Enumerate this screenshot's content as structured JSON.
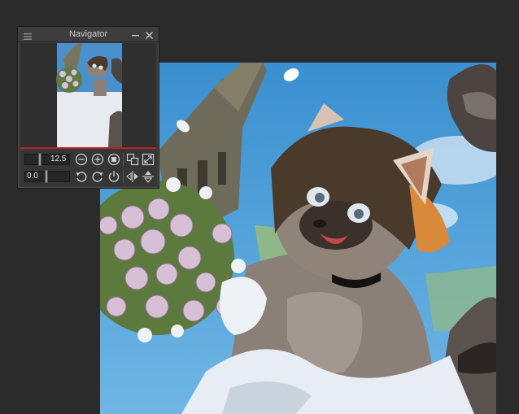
{
  "navigator": {
    "title": "Navigator",
    "zoom_value": "12.5",
    "rotation_value": "0.0",
    "accent_color": "#b82222"
  },
  "icons": {
    "panel_menu": "hamburger-icon",
    "minimize": "minimize-icon",
    "close": "close-icon",
    "zoom_out": "zoom-out-icon",
    "zoom_in": "zoom-in-icon",
    "actual_pixels": "actual-pixels-icon",
    "fit_window": "fit-window-icon",
    "fit_view": "fit-view-icon",
    "rotate_left": "rotate-left-icon",
    "rotate_right": "rotate-right-icon",
    "reset_rotation": "reset-rotation-icon",
    "flip_horizontal": "flip-horizontal-icon",
    "flip_vertical": "flip-vertical-icon"
  }
}
